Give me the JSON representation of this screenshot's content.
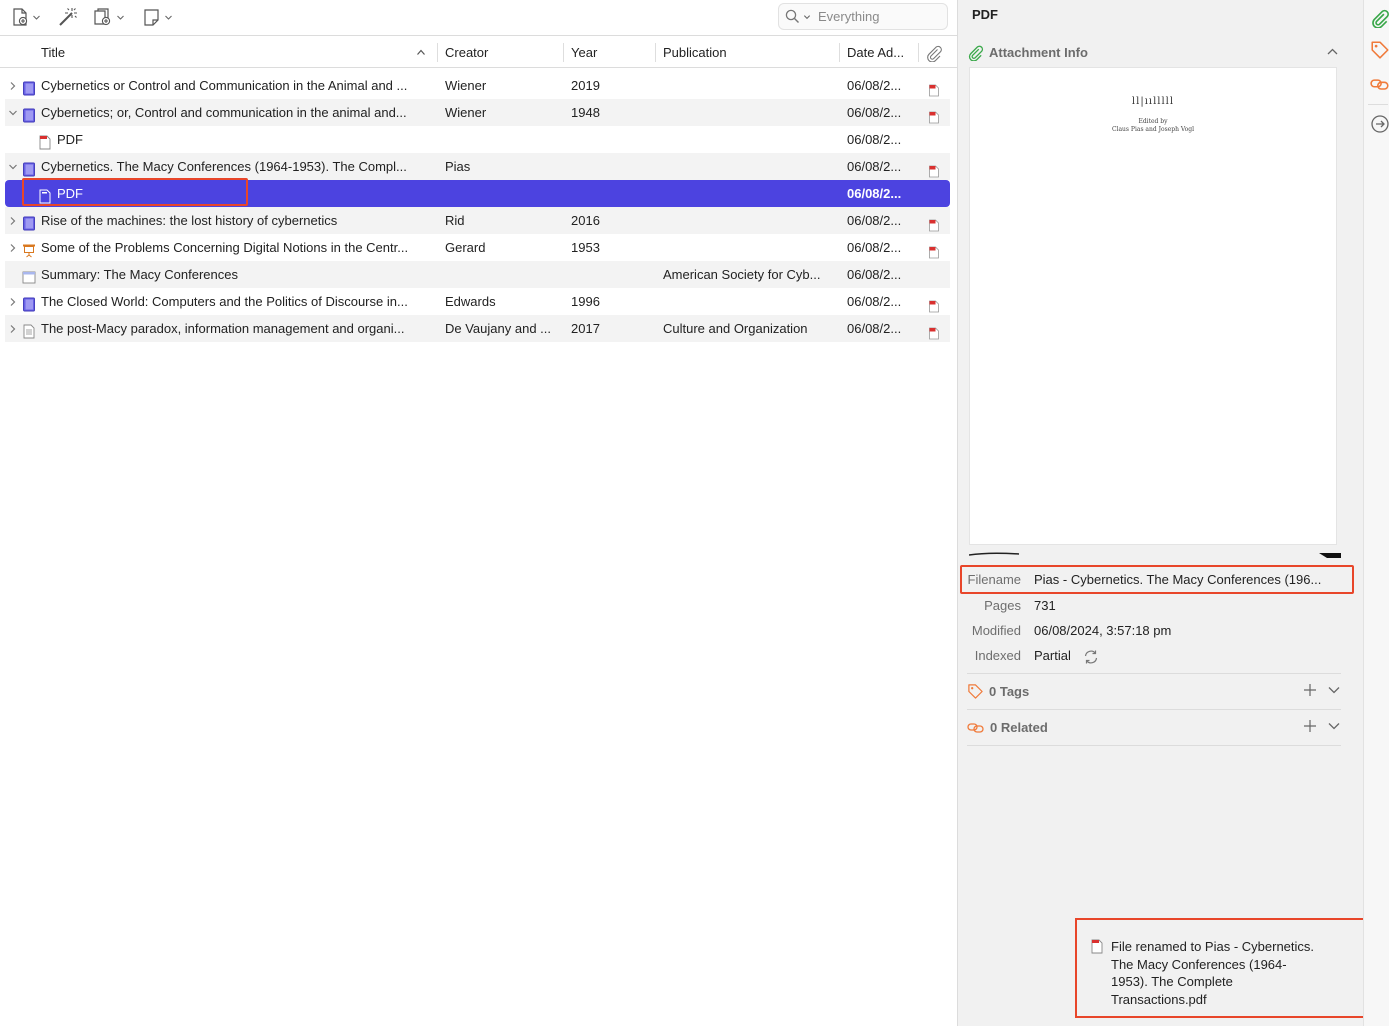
{
  "toolbar": {
    "search_placeholder": "Everything"
  },
  "columns": {
    "title": "Title",
    "creator": "Creator",
    "year": "Year",
    "publication": "Publication",
    "date_added": "Date Ad..."
  },
  "rows": [
    {
      "twisty": "collapsed",
      "type": "book",
      "indent": false,
      "title": "Cybernetics or Control and Communication in the Animal and ...",
      "creator": "Wiener",
      "year": "2019",
      "publication": "",
      "date": "06/08/2...",
      "has_pdf": true
    },
    {
      "twisty": "expanded",
      "type": "book",
      "indent": false,
      "title": "Cybernetics; or, Control and communication in the animal and...",
      "creator": "Wiener",
      "year": "1948",
      "publication": "",
      "date": "06/08/2...",
      "has_pdf": true
    },
    {
      "twisty": "none",
      "type": "pdf",
      "indent": true,
      "title": "PDF",
      "creator": "",
      "year": "",
      "publication": "",
      "date": "06/08/2...",
      "has_pdf": false
    },
    {
      "twisty": "expanded",
      "type": "book",
      "indent": false,
      "title": "Cybernetics. The Macy Conferences (1964-1953). The Compl...",
      "creator": "Pias",
      "year": "",
      "publication": "",
      "date": "06/08/2...",
      "has_pdf": true
    },
    {
      "twisty": "none",
      "type": "pdf",
      "indent": true,
      "title": "PDF",
      "creator": "",
      "year": "",
      "publication": "",
      "date": "06/08/2...",
      "has_pdf": false,
      "selected": true
    },
    {
      "twisty": "collapsed",
      "type": "book",
      "indent": false,
      "title": "Rise of the machines: the lost history of cybernetics",
      "creator": "Rid",
      "year": "2016",
      "publication": "",
      "date": "06/08/2...",
      "has_pdf": true
    },
    {
      "twisty": "collapsed",
      "type": "presentation",
      "indent": false,
      "title": "Some of the Problems Concerning Digital Notions in the Centr...",
      "creator": "Gerard",
      "year": "1953",
      "publication": "",
      "date": "06/08/2...",
      "has_pdf": true
    },
    {
      "twisty": "none",
      "type": "webpage",
      "indent": false,
      "title": "Summary: The Macy Conferences",
      "creator": "",
      "year": "",
      "publication": "American Society for Cyb...",
      "date": "06/08/2...",
      "has_pdf": false
    },
    {
      "twisty": "collapsed",
      "type": "book",
      "indent": false,
      "title": "The Closed World: Computers and the Politics of Discourse in...",
      "creator": "Edwards",
      "year": "1996",
      "publication": "",
      "date": "06/08/2...",
      "has_pdf": true
    },
    {
      "twisty": "collapsed",
      "type": "article",
      "indent": false,
      "title": "The post-Macy paradox, information management and organi...",
      "creator": "De Vaujany and ...",
      "year": "2017",
      "publication": "Culture and Organization",
      "date": "06/08/2...",
      "has_pdf": true
    }
  ],
  "item_pane": {
    "title": "PDF",
    "attachment_info_label": "Attachment Info",
    "preview_text": {
      "line1": "ll|ıılllll",
      "line2": "Edited by",
      "line3": "Claus Pias and Joseph Vogl"
    },
    "fields": [
      {
        "label": "Filename",
        "value": "Pias - Cybernetics. The Macy Conferences (196..."
      },
      {
        "label": "Pages",
        "value": "731"
      },
      {
        "label": "Modified",
        "value": "06/08/2024, 3:57:18 pm"
      },
      {
        "label": "Indexed",
        "value": "Partial"
      }
    ],
    "tags_label": "0 Tags",
    "related_label": "0 Related"
  },
  "toast": {
    "message": "File renamed to Pias - Cybernetics. The Macy Conferences (1964-1953). The Complete Transactions.pdf"
  },
  "colors": {
    "selection": "#4c43e0",
    "highlight": "#e8462a",
    "accent_green": "#3aa84a",
    "accent_orange": "#f07a3a",
    "pdf_red": "#d9302f"
  }
}
